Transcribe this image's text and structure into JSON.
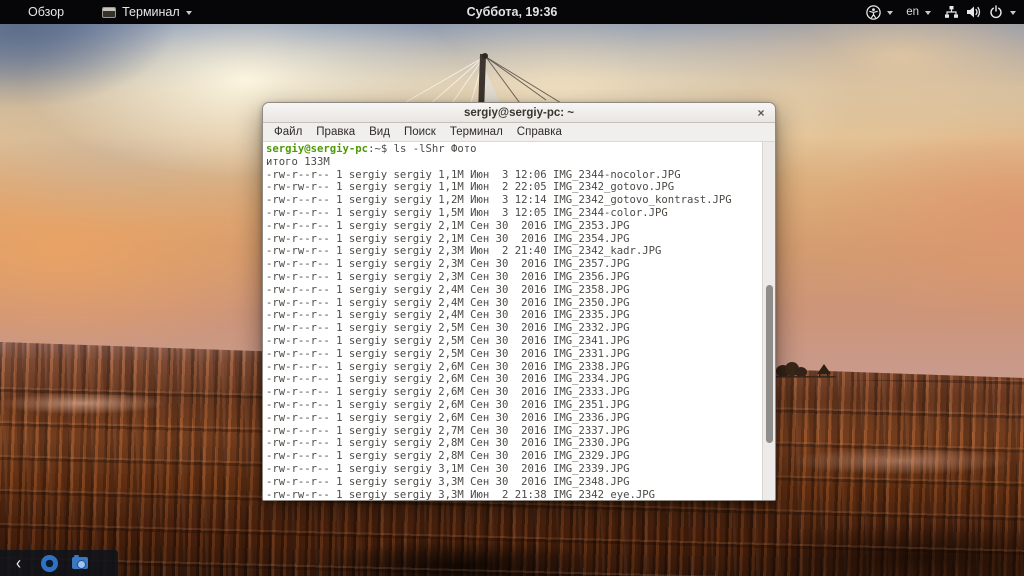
{
  "top_bar": {
    "activities_label": "Обзор",
    "app_menu_label": "Терминал",
    "clock": "Суббота, 19:36",
    "keyboard_layout": "en",
    "icons": [
      "terminal-app-icon",
      "accessibility-icon",
      "network-wired-icon",
      "volume-icon",
      "power-icon"
    ]
  },
  "window": {
    "title": "sergiy@sergiy-pc: ~",
    "close_label": "×",
    "menu_items": [
      "Файл",
      "Правка",
      "Вид",
      "Поиск",
      "Терминал",
      "Справка"
    ]
  },
  "terminal": {
    "prompt_user_host": "sergiy@sergiy-pc",
    "prompt_separator": ":",
    "prompt_path": "~",
    "prompt_symbol": "$ ",
    "command": "ls -lShr Фото",
    "total_line": "итого 133M",
    "files": [
      {
        "perm": "-rw-r--r--",
        "links": "1",
        "owner": "sergiy",
        "group": "sergiy",
        "size": "1,1M",
        "date": "Июн  3 12:06",
        "name": "IMG_2344-nocolor.JPG"
      },
      {
        "perm": "-rw-rw-r--",
        "links": "1",
        "owner": "sergiy",
        "group": "sergiy",
        "size": "1,1M",
        "date": "Июн  2 22:05",
        "name": "IMG_2342_gotovo.JPG"
      },
      {
        "perm": "-rw-r--r--",
        "links": "1",
        "owner": "sergiy",
        "group": "sergiy",
        "size": "1,2M",
        "date": "Июн  3 12:14",
        "name": "IMG_2342_gotovo_kontrast.JPG"
      },
      {
        "perm": "-rw-r--r--",
        "links": "1",
        "owner": "sergiy",
        "group": "sergiy",
        "size": "1,5M",
        "date": "Июн  3 12:05",
        "name": "IMG_2344-color.JPG"
      },
      {
        "perm": "-rw-r--r--",
        "links": "1",
        "owner": "sergiy",
        "group": "sergiy",
        "size": "2,1M",
        "date": "Сен 30  2016",
        "name": "IMG_2353.JPG"
      },
      {
        "perm": "-rw-r--r--",
        "links": "1",
        "owner": "sergiy",
        "group": "sergiy",
        "size": "2,1M",
        "date": "Сен 30  2016",
        "name": "IMG_2354.JPG"
      },
      {
        "perm": "-rw-rw-r--",
        "links": "1",
        "owner": "sergiy",
        "group": "sergiy",
        "size": "2,3M",
        "date": "Июн  2 21:40",
        "name": "IMG_2342_kadr.JPG"
      },
      {
        "perm": "-rw-r--r--",
        "links": "1",
        "owner": "sergiy",
        "group": "sergiy",
        "size": "2,3M",
        "date": "Сен 30  2016",
        "name": "IMG_2357.JPG"
      },
      {
        "perm": "-rw-r--r--",
        "links": "1",
        "owner": "sergiy",
        "group": "sergiy",
        "size": "2,3M",
        "date": "Сен 30  2016",
        "name": "IMG_2356.JPG"
      },
      {
        "perm": "-rw-r--r--",
        "links": "1",
        "owner": "sergiy",
        "group": "sergiy",
        "size": "2,4M",
        "date": "Сен 30  2016",
        "name": "IMG_2358.JPG"
      },
      {
        "perm": "-rw-r--r--",
        "links": "1",
        "owner": "sergiy",
        "group": "sergiy",
        "size": "2,4M",
        "date": "Сен 30  2016",
        "name": "IMG_2350.JPG"
      },
      {
        "perm": "-rw-r--r--",
        "links": "1",
        "owner": "sergiy",
        "group": "sergiy",
        "size": "2,4M",
        "date": "Сен 30  2016",
        "name": "IMG_2335.JPG"
      },
      {
        "perm": "-rw-r--r--",
        "links": "1",
        "owner": "sergiy",
        "group": "sergiy",
        "size": "2,5M",
        "date": "Сен 30  2016",
        "name": "IMG_2332.JPG"
      },
      {
        "perm": "-rw-r--r--",
        "links": "1",
        "owner": "sergiy",
        "group": "sergiy",
        "size": "2,5M",
        "date": "Сен 30  2016",
        "name": "IMG_2341.JPG"
      },
      {
        "perm": "-rw-r--r--",
        "links": "1",
        "owner": "sergiy",
        "group": "sergiy",
        "size": "2,5M",
        "date": "Сен 30  2016",
        "name": "IMG_2331.JPG"
      },
      {
        "perm": "-rw-r--r--",
        "links": "1",
        "owner": "sergiy",
        "group": "sergiy",
        "size": "2,6M",
        "date": "Сен 30  2016",
        "name": "IMG_2338.JPG"
      },
      {
        "perm": "-rw-r--r--",
        "links": "1",
        "owner": "sergiy",
        "group": "sergiy",
        "size": "2,6M",
        "date": "Сен 30  2016",
        "name": "IMG_2334.JPG"
      },
      {
        "perm": "-rw-r--r--",
        "links": "1",
        "owner": "sergiy",
        "group": "sergiy",
        "size": "2,6M",
        "date": "Сен 30  2016",
        "name": "IMG_2333.JPG"
      },
      {
        "perm": "-rw-r--r--",
        "links": "1",
        "owner": "sergiy",
        "group": "sergiy",
        "size": "2,6M",
        "date": "Сен 30  2016",
        "name": "IMG_2351.JPG"
      },
      {
        "perm": "-rw-r--r--",
        "links": "1",
        "owner": "sergiy",
        "group": "sergiy",
        "size": "2,6M",
        "date": "Сен 30  2016",
        "name": "IMG_2336.JPG"
      },
      {
        "perm": "-rw-r--r--",
        "links": "1",
        "owner": "sergiy",
        "group": "sergiy",
        "size": "2,7M",
        "date": "Сен 30  2016",
        "name": "IMG_2337.JPG"
      },
      {
        "perm": "-rw-r--r--",
        "links": "1",
        "owner": "sergiy",
        "group": "sergiy",
        "size": "2,8M",
        "date": "Сен 30  2016",
        "name": "IMG_2330.JPG"
      },
      {
        "perm": "-rw-r--r--",
        "links": "1",
        "owner": "sergiy",
        "group": "sergiy",
        "size": "2,8M",
        "date": "Сен 30  2016",
        "name": "IMG_2329.JPG"
      },
      {
        "perm": "-rw-r--r--",
        "links": "1",
        "owner": "sergiy",
        "group": "sergiy",
        "size": "3,1M",
        "date": "Сен 30  2016",
        "name": "IMG_2339.JPG"
      },
      {
        "perm": "-rw-r--r--",
        "links": "1",
        "owner": "sergiy",
        "group": "sergiy",
        "size": "3,3M",
        "date": "Сен 30  2016",
        "name": "IMG_2348.JPG"
      },
      {
        "perm": "-rw-rw-r--",
        "links": "1",
        "owner": "sergiy",
        "group": "sergiy",
        "size": "3,3M",
        "date": "Июн  2 21:38",
        "name": "IMG_2342_eye.JPG"
      }
    ]
  },
  "colors": {
    "prompt_green": "#4e9a06",
    "topbar_bg": "#060608",
    "terminal_bg": "#ffffff",
    "terminal_fg": "#4d4a46"
  }
}
